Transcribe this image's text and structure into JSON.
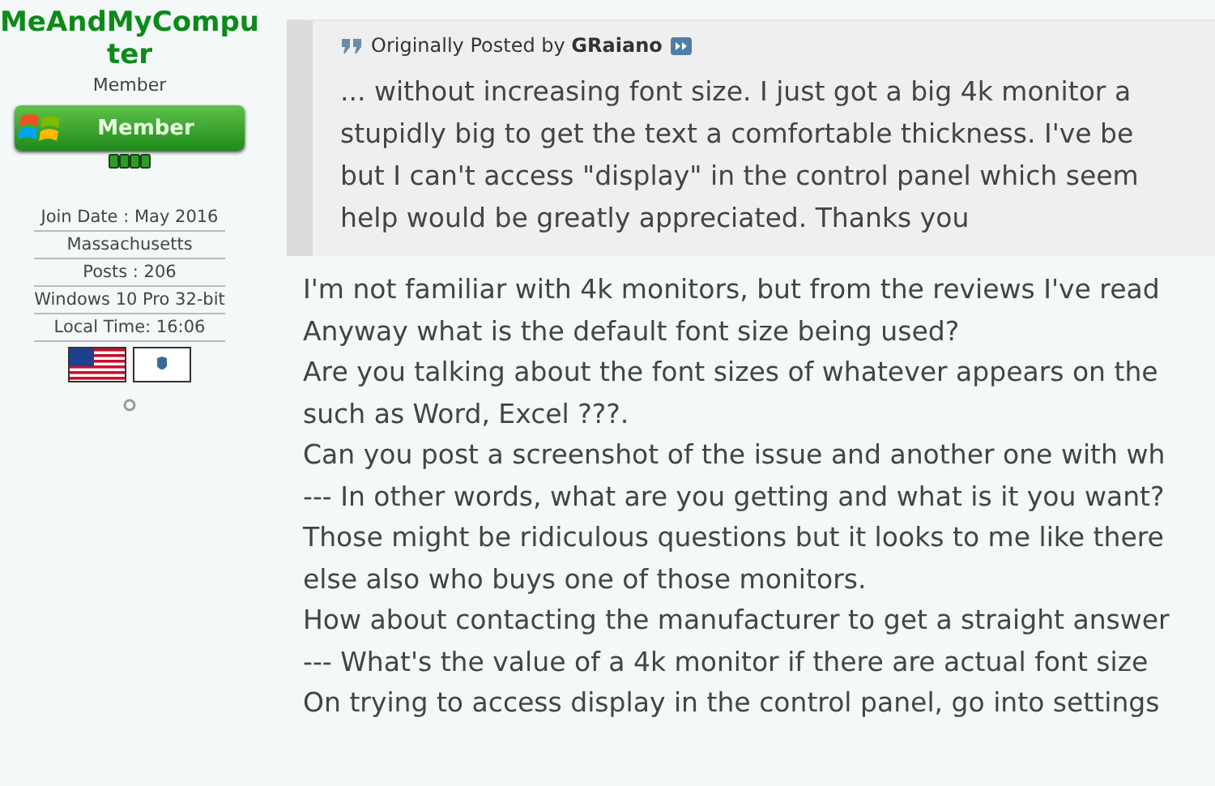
{
  "user": {
    "name": "MeAndMyComputer",
    "title": "Member",
    "badge": "Member",
    "details": [
      "Join Date : May 2016",
      "Massachusetts",
      "Posts : 206",
      "Windows 10 Pro 32-bit",
      "Local Time: 16:06"
    ]
  },
  "quote": {
    "prefix": "Originally Posted by",
    "author": "GRaiano",
    "lines": [
      "... without increasing font size. I just got a big 4k monitor a",
      "stupidly big to get the text a comfortable thickness. I've be",
      "but I can't access \"display\" in the control panel which seem",
      "help would be greatly appreciated. Thanks you"
    ]
  },
  "post_lines": [
    "I'm not familiar with 4k monitors, but from the reviews I've read",
    "Anyway what is the default font size being used?",
    "Are you talking about the font sizes of whatever appears on the",
    "such as Word, Excel ???.",
    "Can you post a screenshot of the issue and another one with wh",
    "--- In other words, what are you getting and what is it you want?",
    "Those might be ridiculous questions but it looks to me like there",
    "else also who buys one of those monitors.",
    "How about contacting the manufacturer to get a straight answer",
    "--- What's the value of a 4k monitor if there are actual font size",
    "On trying to access display in the control panel, go into settings"
  ]
}
